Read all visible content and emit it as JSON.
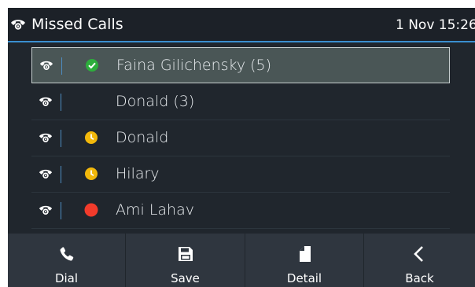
{
  "header": {
    "title": "Missed Calls",
    "clock": "1 Nov 15:26",
    "icon": "missed-call-icon"
  },
  "calls": [
    {
      "name": "Faina Gilichensky (5)",
      "status": "green-check",
      "status_color": "#2dae3c",
      "selected": true
    },
    {
      "name": "Donald (3)",
      "status": "none",
      "status_color": "",
      "selected": false
    },
    {
      "name": "Donald",
      "status": "away-clock",
      "status_color": "#f2b80b",
      "selected": false
    },
    {
      "name": "Hilary",
      "status": "away-clock",
      "status_color": "#f2b80b",
      "selected": false
    },
    {
      "name": "Ami Lahav",
      "status": "busy",
      "status_color": "#f23b2b",
      "selected": false
    }
  ],
  "softkeys": [
    {
      "label": "Dial",
      "icon": "phone-icon"
    },
    {
      "label": "Save",
      "icon": "floppy-disk-icon"
    },
    {
      "label": "Detail",
      "icon": "document-icon"
    },
    {
      "label": "Back",
      "icon": "chevron-left-icon"
    }
  ],
  "colors": {
    "accent": "#3a8fd0",
    "background": "#1c2128",
    "selected_row": "#4a5656"
  }
}
